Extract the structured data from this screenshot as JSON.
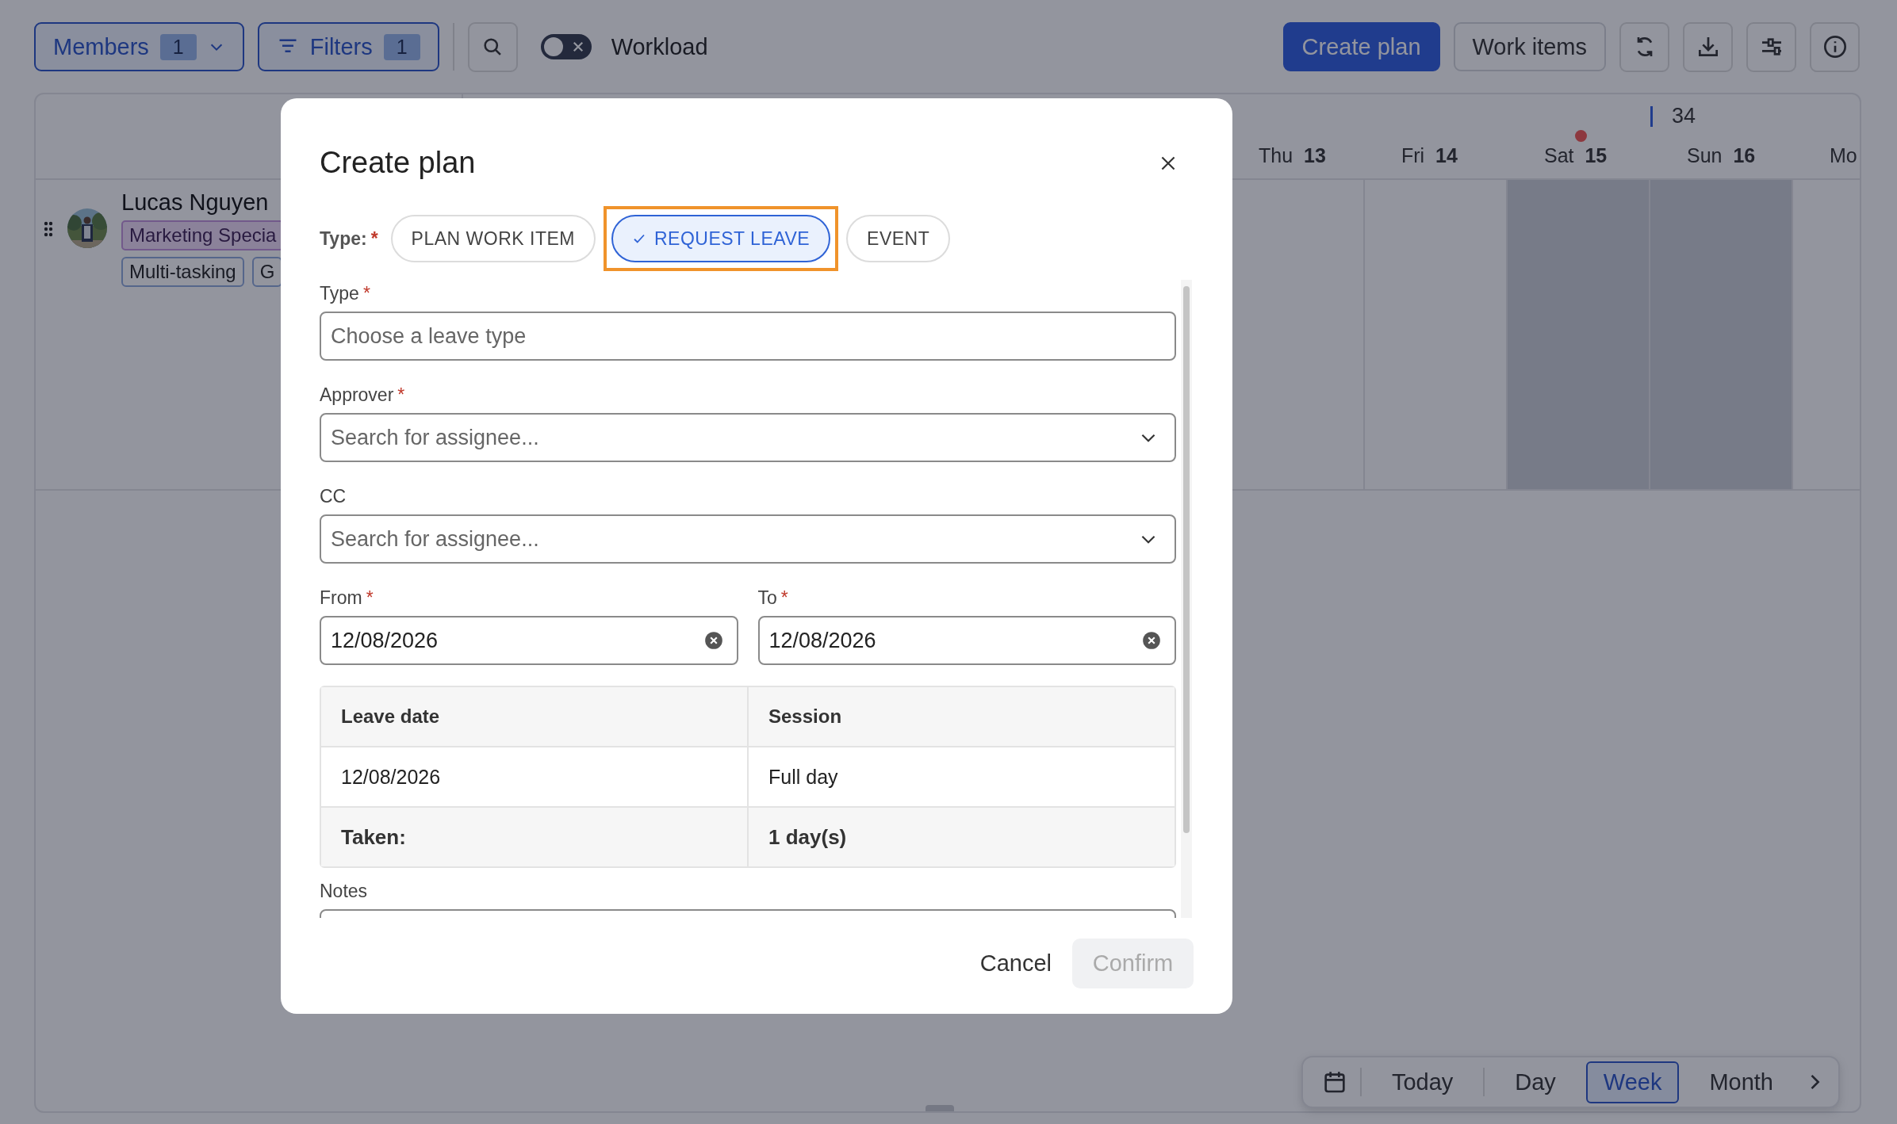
{
  "toolbar": {
    "members": {
      "label": "Members",
      "count": "1"
    },
    "filters": {
      "label": "Filters",
      "count": "1"
    },
    "workload_toggle": {
      "label": "Workload",
      "on": false
    },
    "create_plan": "Create plan",
    "work_items": "Work items"
  },
  "calendar": {
    "days": [
      {
        "name": "Thu",
        "date": "13",
        "weekend": false,
        "has_dot": false
      },
      {
        "name": "Fri",
        "date": "14",
        "weekend": false,
        "has_dot": false
      },
      {
        "name": "Sat",
        "date": "15",
        "weekend": true,
        "has_dot": true
      },
      {
        "name": "Sun",
        "date": "16",
        "weekend": true,
        "has_dot": false,
        "week_label": "34"
      },
      {
        "name": "Mo",
        "weekend": false,
        "has_dot": false
      }
    ],
    "members": [
      {
        "name": "Lucas Nguyen",
        "role": "Marketing Specia",
        "skills": [
          "Multi-tasking",
          "G"
        ]
      }
    ]
  },
  "dialog": {
    "title": "Create plan",
    "type_label": "Type:",
    "type_required_mark": "*",
    "plan_types": [
      {
        "label": "PLAN WORK ITEM",
        "selected": false,
        "highlighted": false
      },
      {
        "label": "REQUEST LEAVE",
        "selected": true,
        "highlighted": true
      },
      {
        "label": "EVENT",
        "selected": false,
        "highlighted": false
      }
    ],
    "fields": [
      {
        "label": "Type",
        "required_mark": "*",
        "placeholder": "Choose a leave type",
        "kind": "select"
      },
      {
        "label": "Approver",
        "required_mark": "*",
        "placeholder": "Search for assignee...",
        "kind": "dropdown"
      },
      {
        "label": "CC",
        "placeholder": "Search for assignee...",
        "kind": "dropdown"
      }
    ],
    "dates": [
      {
        "label": "From",
        "required_mark": "*",
        "value": "12/08/2026"
      },
      {
        "label": "To",
        "required_mark": "*",
        "value": "12/08/2026"
      }
    ],
    "leave_table": {
      "columns": [
        "Leave date",
        "Session"
      ],
      "rows": [
        [
          "12/08/2026",
          "Full day"
        ]
      ],
      "total": [
        "Taken:",
        "1 day(s)"
      ]
    },
    "notes_label": "Notes",
    "cancel": "Cancel",
    "confirm": {
      "label": "Confirm",
      "disabled": true
    }
  },
  "view_switch": [
    {
      "label": "Today",
      "selected": false
    },
    {
      "label": "Day",
      "selected": false
    },
    {
      "label": "Week",
      "selected": true
    },
    {
      "label": "Month",
      "selected": false
    }
  ]
}
